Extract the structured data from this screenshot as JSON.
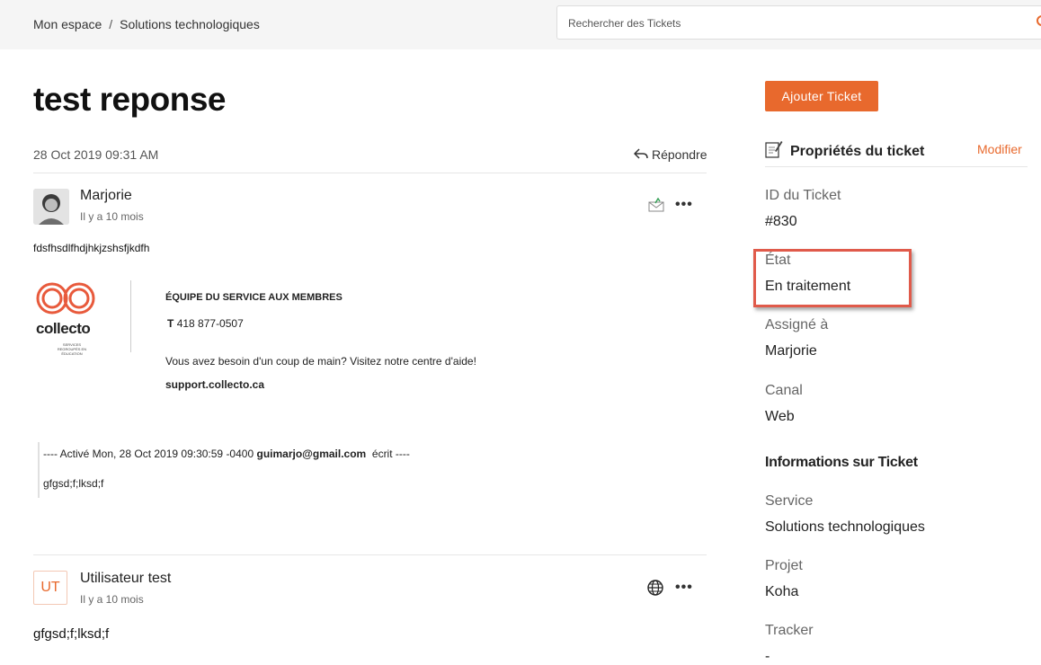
{
  "breadcrumb": {
    "home": "Mon espace",
    "separator": "/",
    "current": "Solutions technologiques"
  },
  "search": {
    "placeholder": "Rechercher des Tickets"
  },
  "ticket": {
    "title": "test reponse",
    "date": "28 Oct 2019 09:31 AM",
    "reply_label": "Répondre"
  },
  "messages": [
    {
      "author": "Marjorie",
      "ago": "Il y a 10 mois",
      "text": "fdsfhsdlfhdjhkjzshsfjkdfh",
      "signature": {
        "logo_text": "collecto",
        "logo_tagline": "SERVICES REGROUPÉS EN ÉDUCATION",
        "team": "ÉQUIPE DU SERVICE AUX MEMBRES",
        "phone_prefix": "T",
        "phone": "418 877-0507",
        "help": "Vous avez besoin d'un coup de main? Visitez notre centre d'aide!",
        "link": "support.collecto.ca"
      },
      "quote_header_prefix": "---- Activé Mon, 28 Oct 2019 09:30:59 -0400",
      "quote_email": "guimarjo@gmail.com",
      "quote_header_suffix": "écrit ----",
      "quote_text": "gfgsd;f;lksd;f"
    },
    {
      "initials": "UT",
      "author": "Utilisateur test",
      "ago": "Il y a 10 mois",
      "text": "gfgsd;f;lksd;f"
    }
  ],
  "sidebar": {
    "add_button": "Ajouter Ticket",
    "properties_title": "Propriétés du ticket",
    "modify": "Modifier",
    "fields": [
      {
        "label": "ID du Ticket",
        "value": "#830"
      },
      {
        "label": "État",
        "value": "En traitement"
      },
      {
        "label": "Assigné à",
        "value": "Marjorie"
      },
      {
        "label": "Canal",
        "value": "Web"
      }
    ],
    "info_title": "Informations sur Ticket",
    "info_fields": [
      {
        "label": "Service",
        "value": "Solutions technologiques"
      },
      {
        "label": "Projet",
        "value": "Koha"
      },
      {
        "label": "Tracker",
        "value": "-"
      }
    ]
  },
  "colors": {
    "accent": "#e8692d",
    "highlight_border": "#e05a4a"
  }
}
